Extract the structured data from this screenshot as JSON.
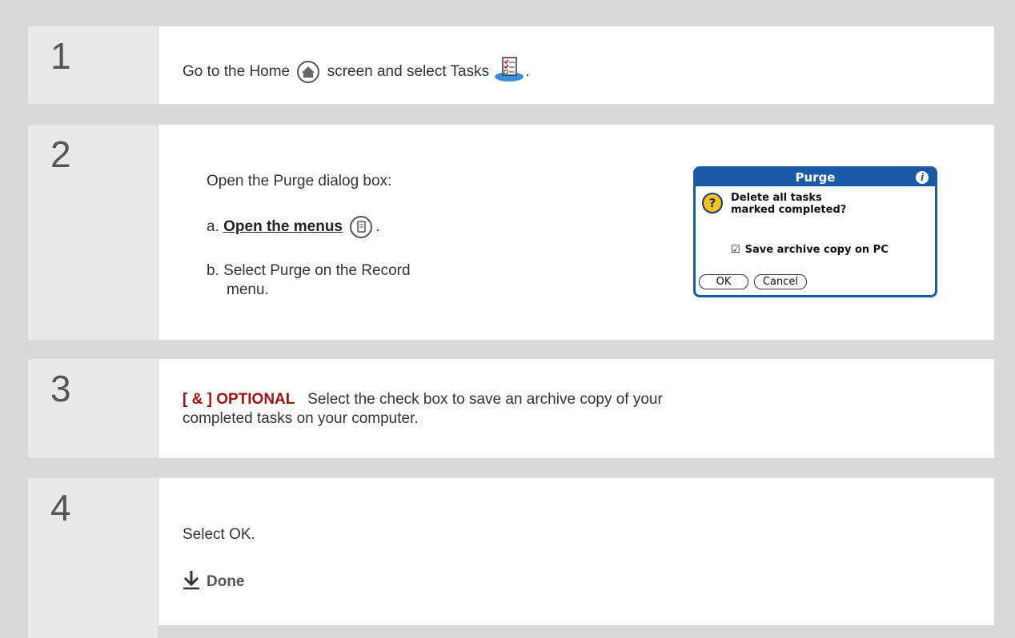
{
  "steps": [
    {
      "number": "1",
      "text_before": "Go to the Home",
      "text_middle": "screen and select Tasks",
      "text_after": ".",
      "home_icon": "home-icon",
      "tasks_icon": "tasks-icon"
    },
    {
      "number": "2",
      "intro": "Open the Purge dialog box:",
      "a_prefix": "a.",
      "a_link": "Open the menus",
      "a_after": ".",
      "menu_icon": "menu-icon",
      "b_prefix": "b.",
      "b_line1": "Select Purge on the Record",
      "b_line2": "menu."
    },
    {
      "number": "3",
      "optional_label": "[ & ]  OPTIONAL",
      "line1": "Select the check box to save an archive copy of your",
      "line2": "completed tasks on your computer."
    },
    {
      "number": "4",
      "text": "Select OK.",
      "done_label": "Done",
      "done_icon": "down-arrow-icon"
    }
  ],
  "dialog": {
    "title": "Purge",
    "info_glyph": "i",
    "question_glyph": "?",
    "message": "Delete all tasks\nmarked completed?",
    "checkbox_glyph": "☑",
    "checkbox_label": "Save archive copy on PC",
    "ok_label": "OK",
    "cancel_label": "Cancel"
  },
  "colors": {
    "dialog_blue": "#1a5ba8",
    "optional_red": "#a40f0f",
    "band_gray": "#d9d9d9"
  }
}
